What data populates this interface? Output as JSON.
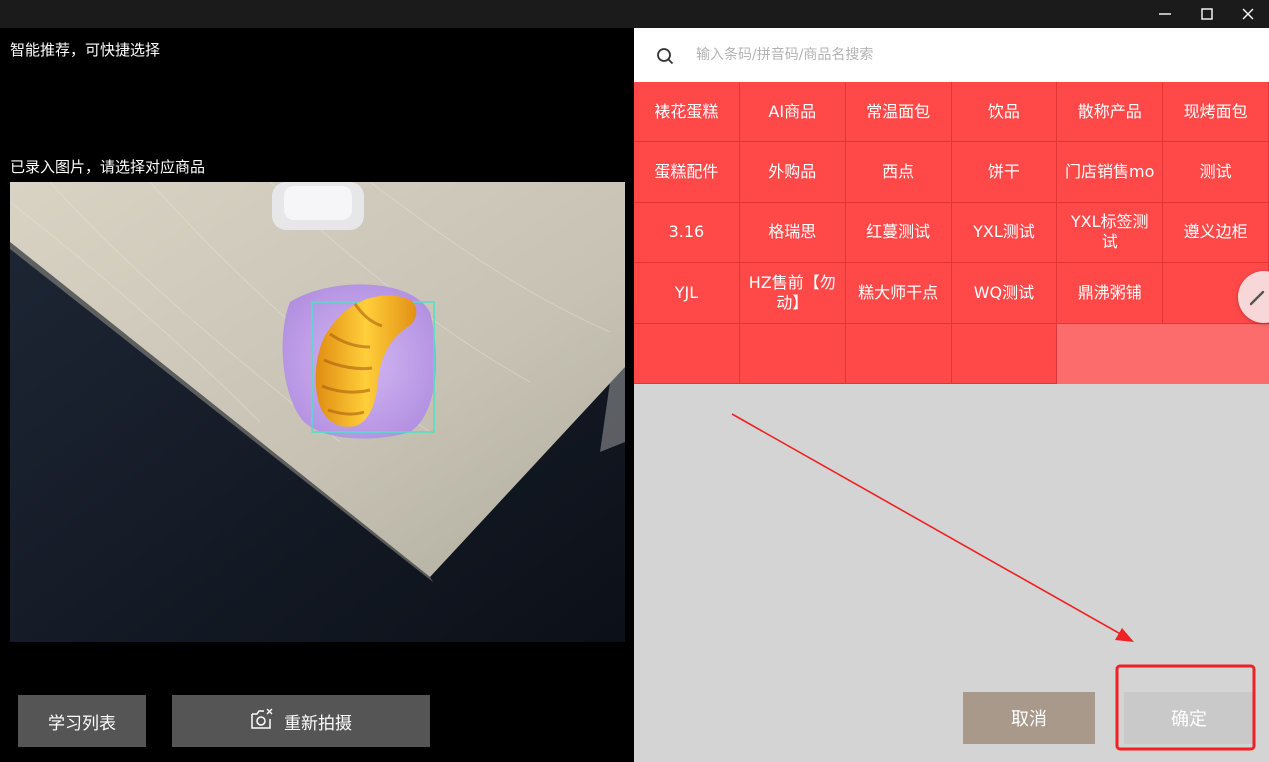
{
  "window": {
    "controls": [
      "minimize-icon",
      "maximize-icon",
      "close-icon"
    ]
  },
  "left": {
    "recommend_hint": "智能推荐，可快捷选择",
    "captured_hint": "已录入图片，请选择对应商品",
    "learn_list_label": "学习列表",
    "retake_label": "重新拍摄",
    "retake_icon": "camera-icon"
  },
  "right": {
    "search": {
      "placeholder": "输入条码/拼音码/商品名搜索",
      "value": "",
      "icon": "search-icon"
    },
    "categories": [
      [
        "裱花蛋糕",
        "AI商品",
        "常温面包",
        "饮品",
        "散称产品",
        "现烤面包"
      ],
      [
        "蛋糕配件",
        "外购品",
        "西点",
        "饼干",
        "门店销售mo",
        "测试"
      ],
      [
        "3.16",
        "格瑞思",
        "红蔓测试",
        "YXL测试",
        "YXL标签测试",
        "遵义边柜"
      ],
      [
        "YJL",
        "HZ售前【勿动】",
        "糕大师干点",
        "WQ测试",
        "鼎沸粥铺",
        ""
      ],
      [
        "",
        "",
        "",
        "",
        "",
        ""
      ]
    ],
    "cancel_label": "取消",
    "confirm_label": "确定"
  },
  "colors": {
    "category_bg": "#ff4949",
    "annotation": "#ee2222",
    "cancel_bg": "#a8998b",
    "confirm_bg": "#c9c9c9",
    "detection_box": "#4fe0c8"
  }
}
